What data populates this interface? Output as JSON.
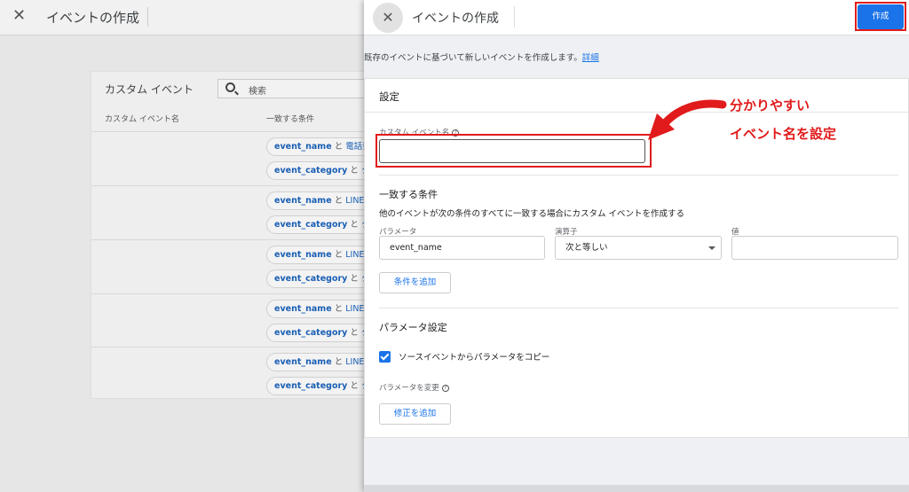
{
  "background": {
    "title": "イベントの作成",
    "card_title": "カスタム イベント",
    "search_placeholder": "検索",
    "columns": [
      "カスタム イベント名",
      "一致する条件"
    ],
    "rows": [
      {
        "chip1_key": "event_name",
        "chip1_op": "と",
        "chip1_val": "電話発信",
        "chip2_key": "event_category",
        "chip2_op": "と",
        "chip2_val": "クリ"
      },
      {
        "chip1_key": "event_name",
        "chip1_op": "と",
        "chip1_val": "LINE友",
        "chip2_key": "event_category",
        "chip2_op": "と",
        "chip2_val": "クリ"
      },
      {
        "chip1_key": "event_name",
        "chip1_op": "と",
        "chip1_val": "LINE友",
        "chip2_key": "event_category",
        "chip2_op": "と",
        "chip2_val": "クリ"
      },
      {
        "chip1_key": "event_name",
        "chip1_op": "と",
        "chip1_val": "LINE友",
        "chip2_key": "event_category",
        "chip2_op": "と",
        "chip2_val": "クリ"
      },
      {
        "chip1_key": "event_name",
        "chip1_op": "と",
        "chip1_val": "LINE友",
        "chip2_key": "event_category",
        "chip2_op": "と",
        "chip2_val": "クリ"
      }
    ]
  },
  "panel": {
    "title": "イベントの作成",
    "create_label": "作成",
    "description": "既存のイベントに基づいて新しいイベントを作成します。",
    "details_link": "詳細",
    "settings_title": "設定",
    "custom_event_name_label": "カスタム イベント名",
    "custom_event_name_value": "",
    "conditions_title": "一致する条件",
    "conditions_desc": "他のイベントが次の条件のすべてに一致する場合にカスタム イベントを作成する",
    "param_label": "パラメータ",
    "param_value": "event_name",
    "operator_label": "演算子",
    "operator_value": "次と等しい",
    "value_label": "値",
    "value_value": "",
    "add_condition_label": "条件を追加",
    "param_settings_title": "パラメータ設定",
    "copy_params_label": "ソースイベントからパラメータをコピー",
    "copy_params_checked": true,
    "modify_params_label": "パラメータを変更",
    "add_modification_label": "修正を追加"
  },
  "annotation": {
    "line1": "分かりやすい",
    "line2": "イベント名を設定"
  },
  "colors": {
    "accent": "#1a73e8",
    "annotation": "#e11b1b"
  }
}
